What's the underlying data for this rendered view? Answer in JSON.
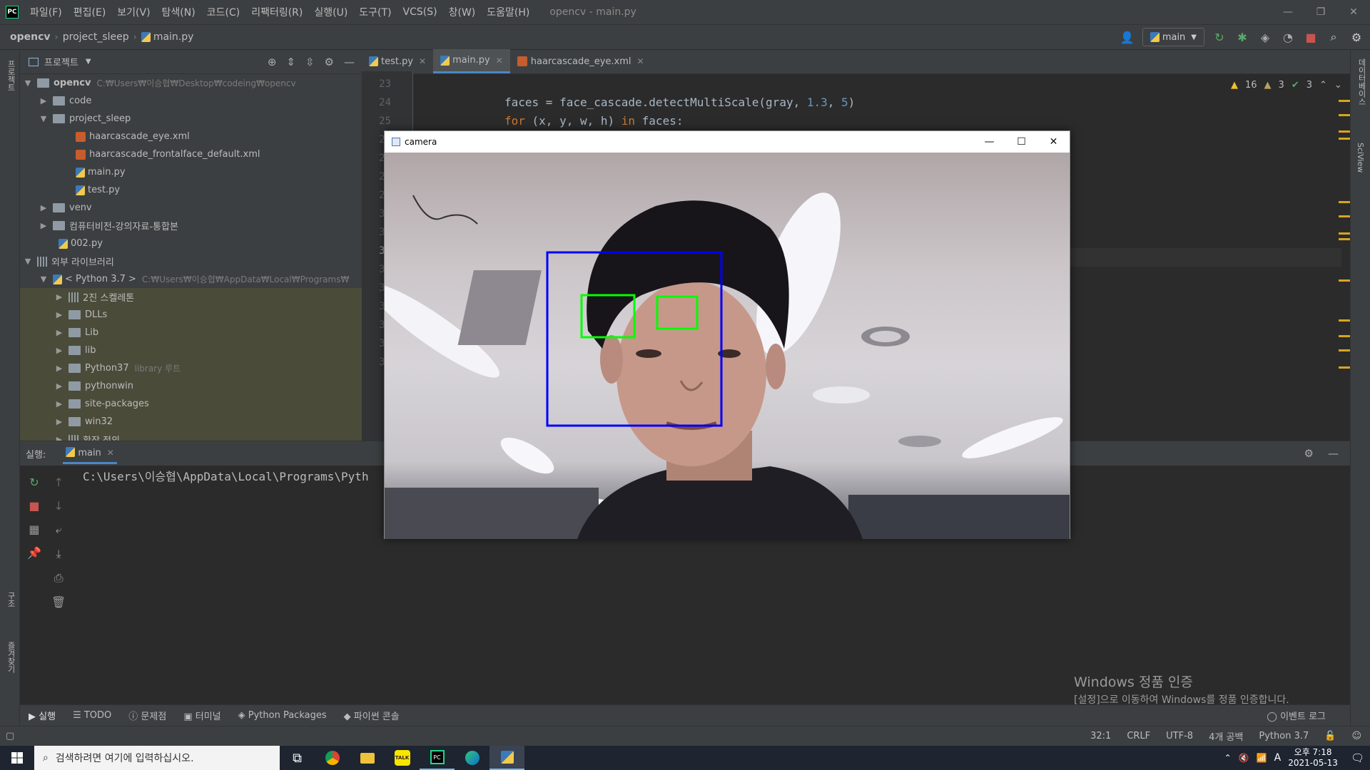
{
  "menubar": {
    "items": [
      "파일(F)",
      "편집(E)",
      "보기(V)",
      "탐색(N)",
      "코드(C)",
      "리팩터링(R)",
      "실행(U)",
      "도구(T)",
      "VCS(S)",
      "창(W)",
      "도움말(H)"
    ],
    "window_title": "opencv - main.py"
  },
  "breadcrumb": {
    "project": "opencv",
    "folder": "project_sleep",
    "file": "main.py"
  },
  "toolbar": {
    "run_config": "main"
  },
  "project_panel": {
    "title": "프로젝트",
    "tree": [
      {
        "label": "opencv",
        "path": "C:₩Users₩이승협₩Desktop₩codeing₩opencv"
      },
      {
        "label": "code"
      },
      {
        "label": "project_sleep"
      },
      {
        "label": "haarcascade_eye.xml"
      },
      {
        "label": "haarcascade_frontalface_default.xml"
      },
      {
        "label": "main.py"
      },
      {
        "label": "test.py"
      },
      {
        "label": "venv"
      },
      {
        "label": "컴퓨터비전-강의자료-통합본"
      },
      {
        "label": "002.py"
      },
      {
        "label": "외부 라이브러리"
      },
      {
        "label": "< Python 3.7 >",
        "path": "C:₩Users₩이승협₩AppData₩Local₩Programs₩"
      },
      {
        "label": "2진 스켈레톤"
      },
      {
        "label": "DLLs"
      },
      {
        "label": "Lib"
      },
      {
        "label": "lib"
      },
      {
        "label": "Python37",
        "note": "library 루트"
      },
      {
        "label": "pythonwin"
      },
      {
        "label": "site-packages"
      },
      {
        "label": "win32"
      },
      {
        "label": "확장 정의"
      }
    ]
  },
  "editor": {
    "tabs": [
      "test.py",
      "main.py",
      "haarcascade_eye.xml"
    ],
    "line_numbers": [
      "23",
      "24",
      "25",
      "26",
      "27",
      "28",
      "29",
      "30",
      "31",
      "32",
      "33",
      "34",
      "35",
      "36",
      "37",
      "38"
    ],
    "code_line_24": {
      "a": "faces = face_cascade.detectMultiScale(gray, ",
      "n1": "1.3",
      "c": ", ",
      "n2": "5",
      "e": ")"
    },
    "code_line_25": {
      "k1": "for",
      "a": " (x, y, w, h) ",
      "k2": "in",
      "b": " faces:"
    },
    "inspections": {
      "warnings": "16",
      "weak_warnings": "3",
      "typos": "3"
    }
  },
  "camera_window": {
    "title": "camera"
  },
  "run_panel": {
    "label": "실행:",
    "tab": "main",
    "console_line": "C:\\Users\\이승협\\AppData\\Local\\Programs\\Pyth"
  },
  "bottom_tabs": [
    "실행",
    "TODO",
    "문제점",
    "터미널",
    "Python Packages",
    "파이썬 콘솔"
  ],
  "event_log": "이벤트 로그",
  "statusbar": {
    "position": "32:1",
    "line_sep": "CRLF",
    "encoding": "UTF-8",
    "indent": "4개 공백",
    "interpreter": "Python 3.7"
  },
  "watermark": {
    "line1": "Windows 정품 인증",
    "line2": "[설정]으로 이동하여 Windows를 정품 인증합니다."
  },
  "side_labels": {
    "left_top": "프로젝트",
    "left_mid": "구조",
    "left_bottom": "즐겨찾기",
    "right_top": "데이터베이스",
    "right_mid": "SciView"
  },
  "taskbar": {
    "search_placeholder": "검색하려면 여기에 입력하십시오.",
    "time": "오후 7:18",
    "date": "2021-05-13",
    "ime": "A"
  }
}
